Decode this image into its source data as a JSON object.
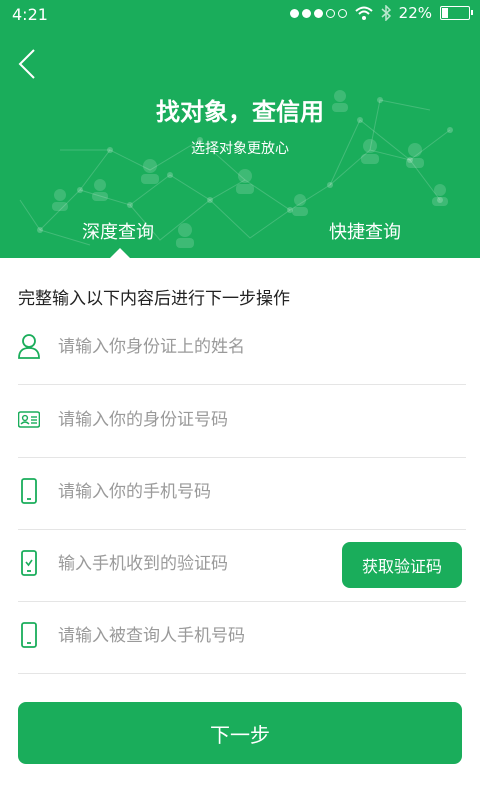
{
  "status_bar": {
    "time": "4:21",
    "battery": "22%",
    "battery_level": 0.22
  },
  "header": {
    "title": "找对象，查信用",
    "subtitle": "选择对象更放心",
    "tabs": [
      {
        "label": "深度查询",
        "active": true
      },
      {
        "label": "快捷查询",
        "active": false
      }
    ]
  },
  "form": {
    "instruction": "完整输入以下内容后进行下一步操作",
    "fields": [
      {
        "placeholder": "请输入你身份证上的姓名",
        "value": "",
        "icon": "person-icon"
      },
      {
        "placeholder": "请输入你的身份证号码",
        "value": "",
        "icon": "id-card-icon"
      },
      {
        "placeholder": "请输入你的手机号码",
        "value": "",
        "icon": "phone-icon"
      },
      {
        "placeholder": "输入手机收到的验证码",
        "value": "",
        "icon": "sms-phone-icon"
      },
      {
        "placeholder": "请输入被查询人手机号码",
        "value": "",
        "icon": "phone-icon"
      }
    ],
    "get_code_label": "获取验证码",
    "next_label": "下一步"
  },
  "colors": {
    "brand": "#1aad5b",
    "divider": "#e5e5e5",
    "placeholder": "#9a9a9a"
  }
}
